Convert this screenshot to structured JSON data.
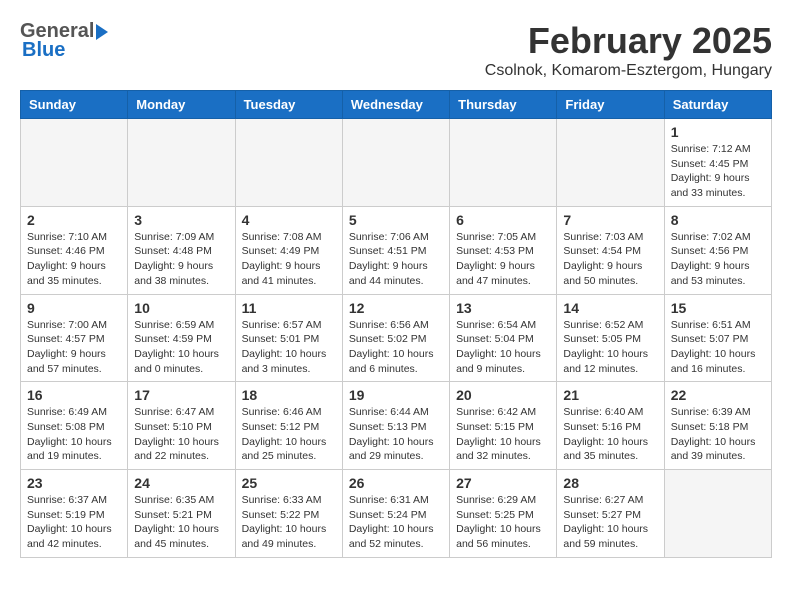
{
  "header": {
    "logo_general": "General",
    "logo_blue": "Blue",
    "month_year": "February 2025",
    "location": "Csolnok, Komarom-Esztergom, Hungary"
  },
  "days_of_week": [
    "Sunday",
    "Monday",
    "Tuesday",
    "Wednesday",
    "Thursday",
    "Friday",
    "Saturday"
  ],
  "weeks": [
    [
      {
        "day": "",
        "info": ""
      },
      {
        "day": "",
        "info": ""
      },
      {
        "day": "",
        "info": ""
      },
      {
        "day": "",
        "info": ""
      },
      {
        "day": "",
        "info": ""
      },
      {
        "day": "",
        "info": ""
      },
      {
        "day": "1",
        "info": "Sunrise: 7:12 AM\nSunset: 4:45 PM\nDaylight: 9 hours and 33 minutes."
      }
    ],
    [
      {
        "day": "2",
        "info": "Sunrise: 7:10 AM\nSunset: 4:46 PM\nDaylight: 9 hours and 35 minutes."
      },
      {
        "day": "3",
        "info": "Sunrise: 7:09 AM\nSunset: 4:48 PM\nDaylight: 9 hours and 38 minutes."
      },
      {
        "day": "4",
        "info": "Sunrise: 7:08 AM\nSunset: 4:49 PM\nDaylight: 9 hours and 41 minutes."
      },
      {
        "day": "5",
        "info": "Sunrise: 7:06 AM\nSunset: 4:51 PM\nDaylight: 9 hours and 44 minutes."
      },
      {
        "day": "6",
        "info": "Sunrise: 7:05 AM\nSunset: 4:53 PM\nDaylight: 9 hours and 47 minutes."
      },
      {
        "day": "7",
        "info": "Sunrise: 7:03 AM\nSunset: 4:54 PM\nDaylight: 9 hours and 50 minutes."
      },
      {
        "day": "8",
        "info": "Sunrise: 7:02 AM\nSunset: 4:56 PM\nDaylight: 9 hours and 53 minutes."
      }
    ],
    [
      {
        "day": "9",
        "info": "Sunrise: 7:00 AM\nSunset: 4:57 PM\nDaylight: 9 hours and 57 minutes."
      },
      {
        "day": "10",
        "info": "Sunrise: 6:59 AM\nSunset: 4:59 PM\nDaylight: 10 hours and 0 minutes."
      },
      {
        "day": "11",
        "info": "Sunrise: 6:57 AM\nSunset: 5:01 PM\nDaylight: 10 hours and 3 minutes."
      },
      {
        "day": "12",
        "info": "Sunrise: 6:56 AM\nSunset: 5:02 PM\nDaylight: 10 hours and 6 minutes."
      },
      {
        "day": "13",
        "info": "Sunrise: 6:54 AM\nSunset: 5:04 PM\nDaylight: 10 hours and 9 minutes."
      },
      {
        "day": "14",
        "info": "Sunrise: 6:52 AM\nSunset: 5:05 PM\nDaylight: 10 hours and 12 minutes."
      },
      {
        "day": "15",
        "info": "Sunrise: 6:51 AM\nSunset: 5:07 PM\nDaylight: 10 hours and 16 minutes."
      }
    ],
    [
      {
        "day": "16",
        "info": "Sunrise: 6:49 AM\nSunset: 5:08 PM\nDaylight: 10 hours and 19 minutes."
      },
      {
        "day": "17",
        "info": "Sunrise: 6:47 AM\nSunset: 5:10 PM\nDaylight: 10 hours and 22 minutes."
      },
      {
        "day": "18",
        "info": "Sunrise: 6:46 AM\nSunset: 5:12 PM\nDaylight: 10 hours and 25 minutes."
      },
      {
        "day": "19",
        "info": "Sunrise: 6:44 AM\nSunset: 5:13 PM\nDaylight: 10 hours and 29 minutes."
      },
      {
        "day": "20",
        "info": "Sunrise: 6:42 AM\nSunset: 5:15 PM\nDaylight: 10 hours and 32 minutes."
      },
      {
        "day": "21",
        "info": "Sunrise: 6:40 AM\nSunset: 5:16 PM\nDaylight: 10 hours and 35 minutes."
      },
      {
        "day": "22",
        "info": "Sunrise: 6:39 AM\nSunset: 5:18 PM\nDaylight: 10 hours and 39 minutes."
      }
    ],
    [
      {
        "day": "23",
        "info": "Sunrise: 6:37 AM\nSunset: 5:19 PM\nDaylight: 10 hours and 42 minutes."
      },
      {
        "day": "24",
        "info": "Sunrise: 6:35 AM\nSunset: 5:21 PM\nDaylight: 10 hours and 45 minutes."
      },
      {
        "day": "25",
        "info": "Sunrise: 6:33 AM\nSunset: 5:22 PM\nDaylight: 10 hours and 49 minutes."
      },
      {
        "day": "26",
        "info": "Sunrise: 6:31 AM\nSunset: 5:24 PM\nDaylight: 10 hours and 52 minutes."
      },
      {
        "day": "27",
        "info": "Sunrise: 6:29 AM\nSunset: 5:25 PM\nDaylight: 10 hours and 56 minutes."
      },
      {
        "day": "28",
        "info": "Sunrise: 6:27 AM\nSunset: 5:27 PM\nDaylight: 10 hours and 59 minutes."
      },
      {
        "day": "",
        "info": ""
      }
    ]
  ]
}
